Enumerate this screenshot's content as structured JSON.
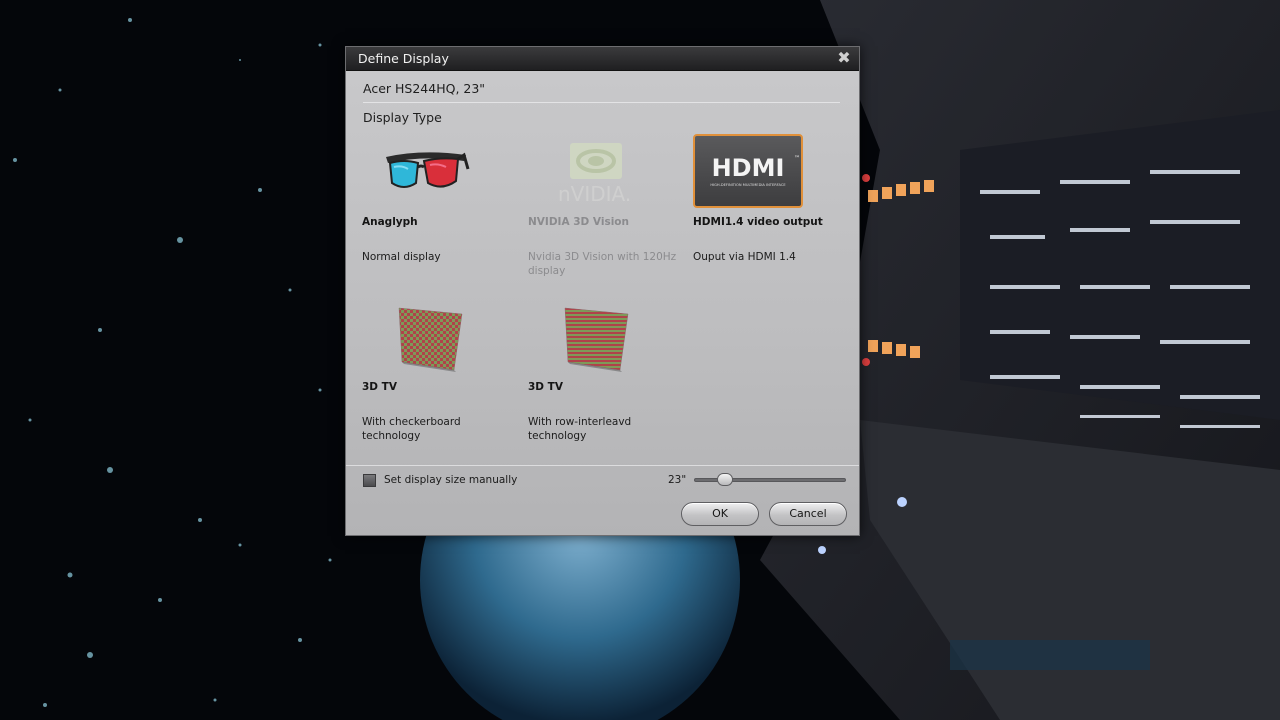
{
  "dialog": {
    "title": "Define Display",
    "close_glyph": "✖",
    "display_name": "Acer HS244HQ, 23\"",
    "section_title": "Display Type"
  },
  "options": [
    {
      "id": "anaglyph",
      "title": "Anaglyph",
      "description": "Normal display",
      "icon": "anaglyph-glasses-icon",
      "enabled": true,
      "selected": false
    },
    {
      "id": "nvidia",
      "title": "NVIDIA 3D Vision",
      "description": "Nvidia 3D Vision with 120Hz display",
      "icon": "nvidia-logo-icon",
      "logo_text": "nVIDIA.",
      "enabled": false,
      "selected": false
    },
    {
      "id": "hdmi",
      "title": "HDMI1.4 video output",
      "description": "Ouput via HDMI 1.4",
      "icon": "hdmi-logo-icon",
      "logo_text": "HDMI",
      "logo_tm": "™",
      "logo_subtext": "HIGH-DEFINITION MULTIMEDIA INTERFACE",
      "enabled": true,
      "selected": true
    },
    {
      "id": "checker",
      "title": "3D TV",
      "description": "With checkerboard technology",
      "icon": "checkerboard-pattern-icon",
      "enabled": true,
      "selected": false
    },
    {
      "id": "rows",
      "title": "3D TV",
      "description": "With row-interleavd technology",
      "icon": "row-interleaved-pattern-icon",
      "enabled": true,
      "selected": false
    }
  ],
  "size": {
    "checkbox_label": "Set display size manually",
    "checked": false,
    "value_label": "23\"",
    "slider_fraction": 0.17
  },
  "buttons": {
    "ok": "OK",
    "cancel": "Cancel"
  },
  "colors": {
    "selection_border": "#e0903a",
    "pattern_red": "#b0424a",
    "pattern_green": "#7e9a58"
  }
}
